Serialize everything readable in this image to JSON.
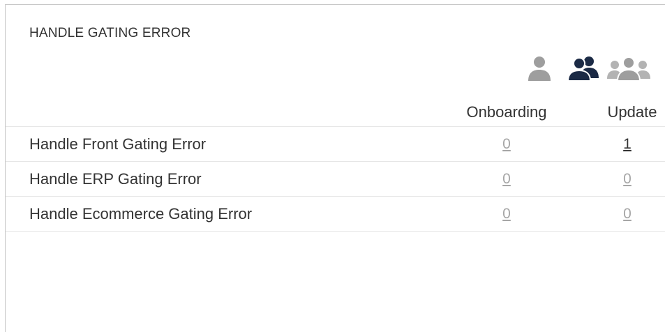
{
  "panel": {
    "title": "HANDLE GATING ERROR"
  },
  "filters": [
    {
      "icon": "single-user-icon",
      "state": "inactive",
      "color": "#9e9e9e"
    },
    {
      "icon": "two-users-icon",
      "state": "active",
      "color": "#1b2a45"
    },
    {
      "icon": "user-group-icon",
      "state": "inactive",
      "color": "#9e9e9e"
    }
  ],
  "columns": {
    "onboarding": "Onboarding",
    "update": "Update"
  },
  "rows": [
    {
      "label": "Handle Front Gating Error",
      "onboarding": "0",
      "update": "1"
    },
    {
      "label": "Handle ERP Gating Error",
      "onboarding": "0",
      "update": "0"
    },
    {
      "label": "Handle Ecommerce Gating Error",
      "onboarding": "0",
      "update": "0"
    }
  ],
  "colors": {
    "text": "#333333",
    "zero_value": "#a6a6a6",
    "active_icon": "#1b2a45",
    "inactive_icon": "#9e9e9e",
    "divider": "#e6e6e6"
  }
}
